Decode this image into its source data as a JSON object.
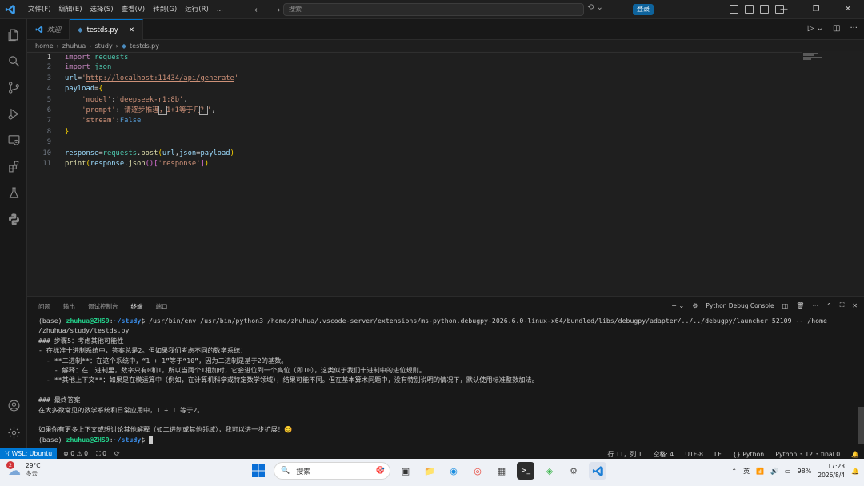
{
  "titlebar": {
    "menu": [
      "文件(F)",
      "编辑(E)",
      "选择(S)",
      "查看(V)",
      "转到(G)",
      "运行(R)",
      "..."
    ],
    "search_placeholder": "搜索",
    "login_label": "登录"
  },
  "tabs": [
    {
      "label": "欢迎",
      "icon": "vscode-logo-icon"
    },
    {
      "label": "testds.py",
      "icon": "python-icon",
      "close": "✕"
    }
  ],
  "breadcrumb": [
    "home",
    "zhuhua",
    "study",
    "testds.py"
  ],
  "editor": {
    "lines": [
      {
        "n": "1"
      },
      {
        "n": "2"
      },
      {
        "n": "3"
      },
      {
        "n": "4"
      },
      {
        "n": "5"
      },
      {
        "n": "6"
      },
      {
        "n": "7"
      },
      {
        "n": "8"
      },
      {
        "n": "9"
      },
      {
        "n": "10"
      },
      {
        "n": "11"
      }
    ],
    "code": {
      "import": "import",
      "requests": "requests",
      "json": "json",
      "url_var": "url",
      "url_str": "http://localhost:11434/api/generate",
      "payload": "payload",
      "key_model": "'model'",
      "val_model": "'deepseek-r1:8b'",
      "key_prompt": "'prompt'",
      "val_prompt_a": "'请逐步推理",
      "val_prompt_b": "，",
      "val_prompt_c": "1+1等于几",
      "val_prompt_d": "？",
      "val_prompt_e": "'",
      "key_stream": "'stream'",
      "val_stream": "False",
      "response": "response",
      "requests_ref": "requests",
      "post": "post",
      "url_arg": "url",
      "json_kw": "json",
      "print": "print",
      "json_call": "json",
      "key_response": "'response'"
    }
  },
  "panel": {
    "tabs": [
      "问题",
      "输出",
      "调试控制台",
      "终端",
      "端口"
    ],
    "active_tab": "终端",
    "terminal_name": "Python Debug Console",
    "terminal": {
      "prompt_user": "zhuhua@ZHS9",
      "prompt_path": "~/study",
      "base": "(base)",
      "cmd1": " /usr/bin/env /usr/bin/python3 /home/zhuhua/.vscode-server/extensions/ms-python.debugpy-2026.6.0-linux-x64/bundled/libs/debugpy/adapter/../../debugpy/launcher 52109 -- /home",
      "cmd1_cont": "/zhuhua/study/testds.py",
      "out": [
        "### 步骤5：考虑其他可能性",
        "- 在标准十进制系统中，答案总是2。但如果我们考虑不同的数学系统：",
        "  - **二进制**：在这个系统中，“1 + 1”等于“10”，因为二进制是基于2的基数。",
        "    - 解释：在二进制里，数字只有0和1，所以当两个1相加时，它会进位到一个高位（即10），这类似于我们十进制中的进位规则。",
        "  - **其他上下文**：如果是在模运算中（例如，在计算机科学或特定数学领域），结果可能不同。但在基本算术问题中，没有特别说明的情况下，默认使用标准整数加法。",
        "",
        "### 最终答案",
        "在大多数常见的数学系统和日常应用中，1 + 1 等于2。",
        "",
        "如果你有更多上下文或想讨论其他解释（如二进制或其他领域），我可以进一步扩展！😊"
      ]
    }
  },
  "statusbar": {
    "remote": "WSL: Ubuntu",
    "errors": "0",
    "warnings": "0",
    "ports": "0",
    "line_col": "行 11，列 1",
    "spaces": "空格: 4",
    "encoding": "UTF-8",
    "eol": "LF",
    "lang_braces": "{}",
    "language": "Python",
    "interpreter": "Python 3.12.3.final.0"
  },
  "taskbar": {
    "temp": "29°C",
    "weather": "多云",
    "badge": "2",
    "search": "搜索",
    "ime": "英",
    "battery": "98%",
    "time": "17:23",
    "date": "2026/8/4"
  },
  "colors": {
    "accent": "#0078d4",
    "keyword": "#c586c0",
    "string": "#ce9178",
    "module": "#4ec9b0"
  }
}
